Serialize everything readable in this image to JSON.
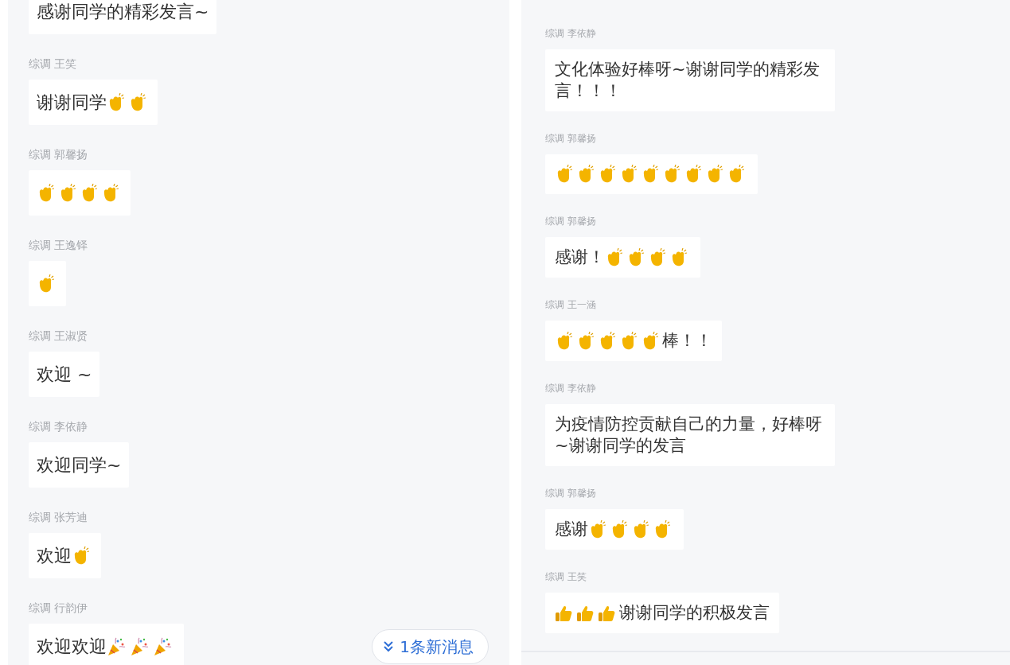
{
  "panels": [
    {
      "messages": [
        {
          "parts": [
            {
              "kind": "text",
              "text": "感谢同学的精彩发言~"
            }
          ]
        },
        {
          "sender": "综调 王笑",
          "parts": [
            {
              "kind": "text",
              "text": "谢谢同学"
            },
            {
              "kind": "clap"
            },
            {
              "kind": "clap"
            }
          ]
        },
        {
          "sender": "综调 郭馨扬",
          "parts": [
            {
              "kind": "clap"
            },
            {
              "kind": "clap"
            },
            {
              "kind": "clap"
            },
            {
              "kind": "clap"
            }
          ]
        },
        {
          "sender": "综调 王逸铎",
          "parts": [
            {
              "kind": "clap"
            }
          ]
        },
        {
          "sender": "综调 王淑贤",
          "parts": [
            {
              "kind": "text",
              "text": "欢迎 ~"
            }
          ]
        },
        {
          "sender": "综调 李依静",
          "parts": [
            {
              "kind": "text",
              "text": "欢迎同学~"
            }
          ]
        },
        {
          "sender": "综调 张芳迪",
          "parts": [
            {
              "kind": "text",
              "text": "欢迎"
            },
            {
              "kind": "clap"
            }
          ]
        },
        {
          "sender": "综调 行韵伊",
          "parts": [
            {
              "kind": "text",
              "text": "欢迎欢迎"
            },
            {
              "kind": "party"
            },
            {
              "kind": "party"
            },
            {
              "kind": "party"
            }
          ]
        }
      ],
      "new_messages_button": "1条新消息"
    },
    {
      "messages": [
        {
          "sender": "综调 李依静",
          "parts": [
            {
              "kind": "text",
              "text": "文化体验好棒呀~谢谢同学的精彩发言！！！"
            }
          ]
        },
        {
          "sender": "综调 郭馨扬",
          "parts": [
            {
              "kind": "clap"
            },
            {
              "kind": "clap"
            },
            {
              "kind": "clap"
            },
            {
              "kind": "clap"
            },
            {
              "kind": "clap"
            },
            {
              "kind": "clap"
            },
            {
              "kind": "clap"
            },
            {
              "kind": "clap"
            },
            {
              "kind": "clap"
            }
          ]
        },
        {
          "sender": "综调 郭馨扬",
          "parts": [
            {
              "kind": "text",
              "text": "感谢！"
            },
            {
              "kind": "clap"
            },
            {
              "kind": "clap"
            },
            {
              "kind": "clap"
            },
            {
              "kind": "clap"
            }
          ]
        },
        {
          "sender": "综调 王一涵",
          "parts": [
            {
              "kind": "clap"
            },
            {
              "kind": "clap"
            },
            {
              "kind": "clap"
            },
            {
              "kind": "clap"
            },
            {
              "kind": "clap"
            },
            {
              "kind": "text",
              "text": "棒！！"
            }
          ]
        },
        {
          "sender": "综调 李依静",
          "parts": [
            {
              "kind": "text",
              "text": "为疫情防控贡献自己的力量，好棒呀~谢谢同学的发言"
            }
          ]
        },
        {
          "sender": "综调 郭馨扬",
          "parts": [
            {
              "kind": "text",
              "text": "感谢"
            },
            {
              "kind": "clap"
            },
            {
              "kind": "clap"
            },
            {
              "kind": "clap"
            },
            {
              "kind": "clap"
            }
          ]
        },
        {
          "sender": "综调 王笑",
          "parts": [
            {
              "kind": "thumb"
            },
            {
              "kind": "thumb"
            },
            {
              "kind": "thumb"
            },
            {
              "kind": "text",
              "text": "谢谢同学的积极发言"
            }
          ]
        }
      ]
    }
  ]
}
